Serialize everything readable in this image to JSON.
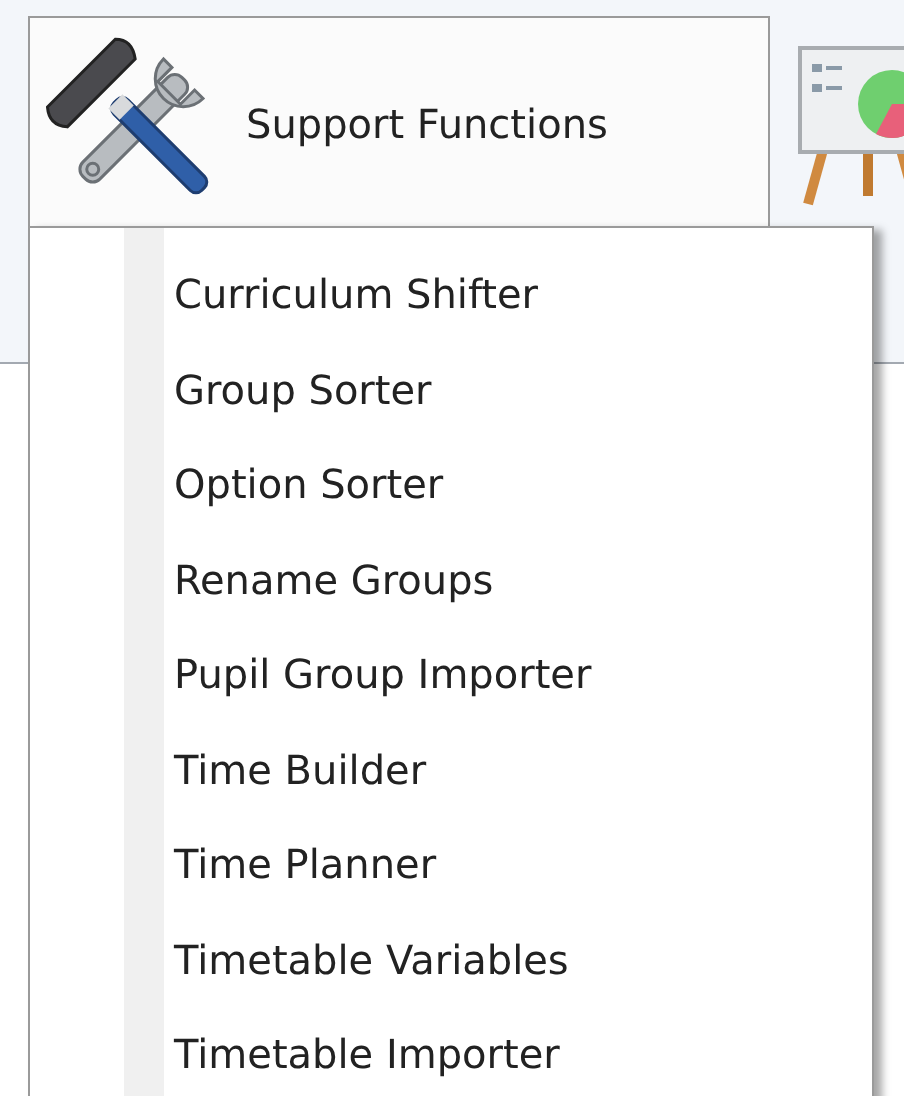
{
  "ribbon_button": {
    "label": "Support Functions",
    "expanded": true
  },
  "menu_items": [
    {
      "label": "Curriculum Shifter"
    },
    {
      "label": "Group Sorter"
    },
    {
      "label": "Option Sorter"
    },
    {
      "label": "Rename Groups"
    },
    {
      "label": "Pupil Group Importer"
    },
    {
      "label": "Time Builder"
    },
    {
      "label": "Time Planner"
    },
    {
      "label": "Timetable Variables"
    },
    {
      "label": "Timetable Importer"
    }
  ]
}
